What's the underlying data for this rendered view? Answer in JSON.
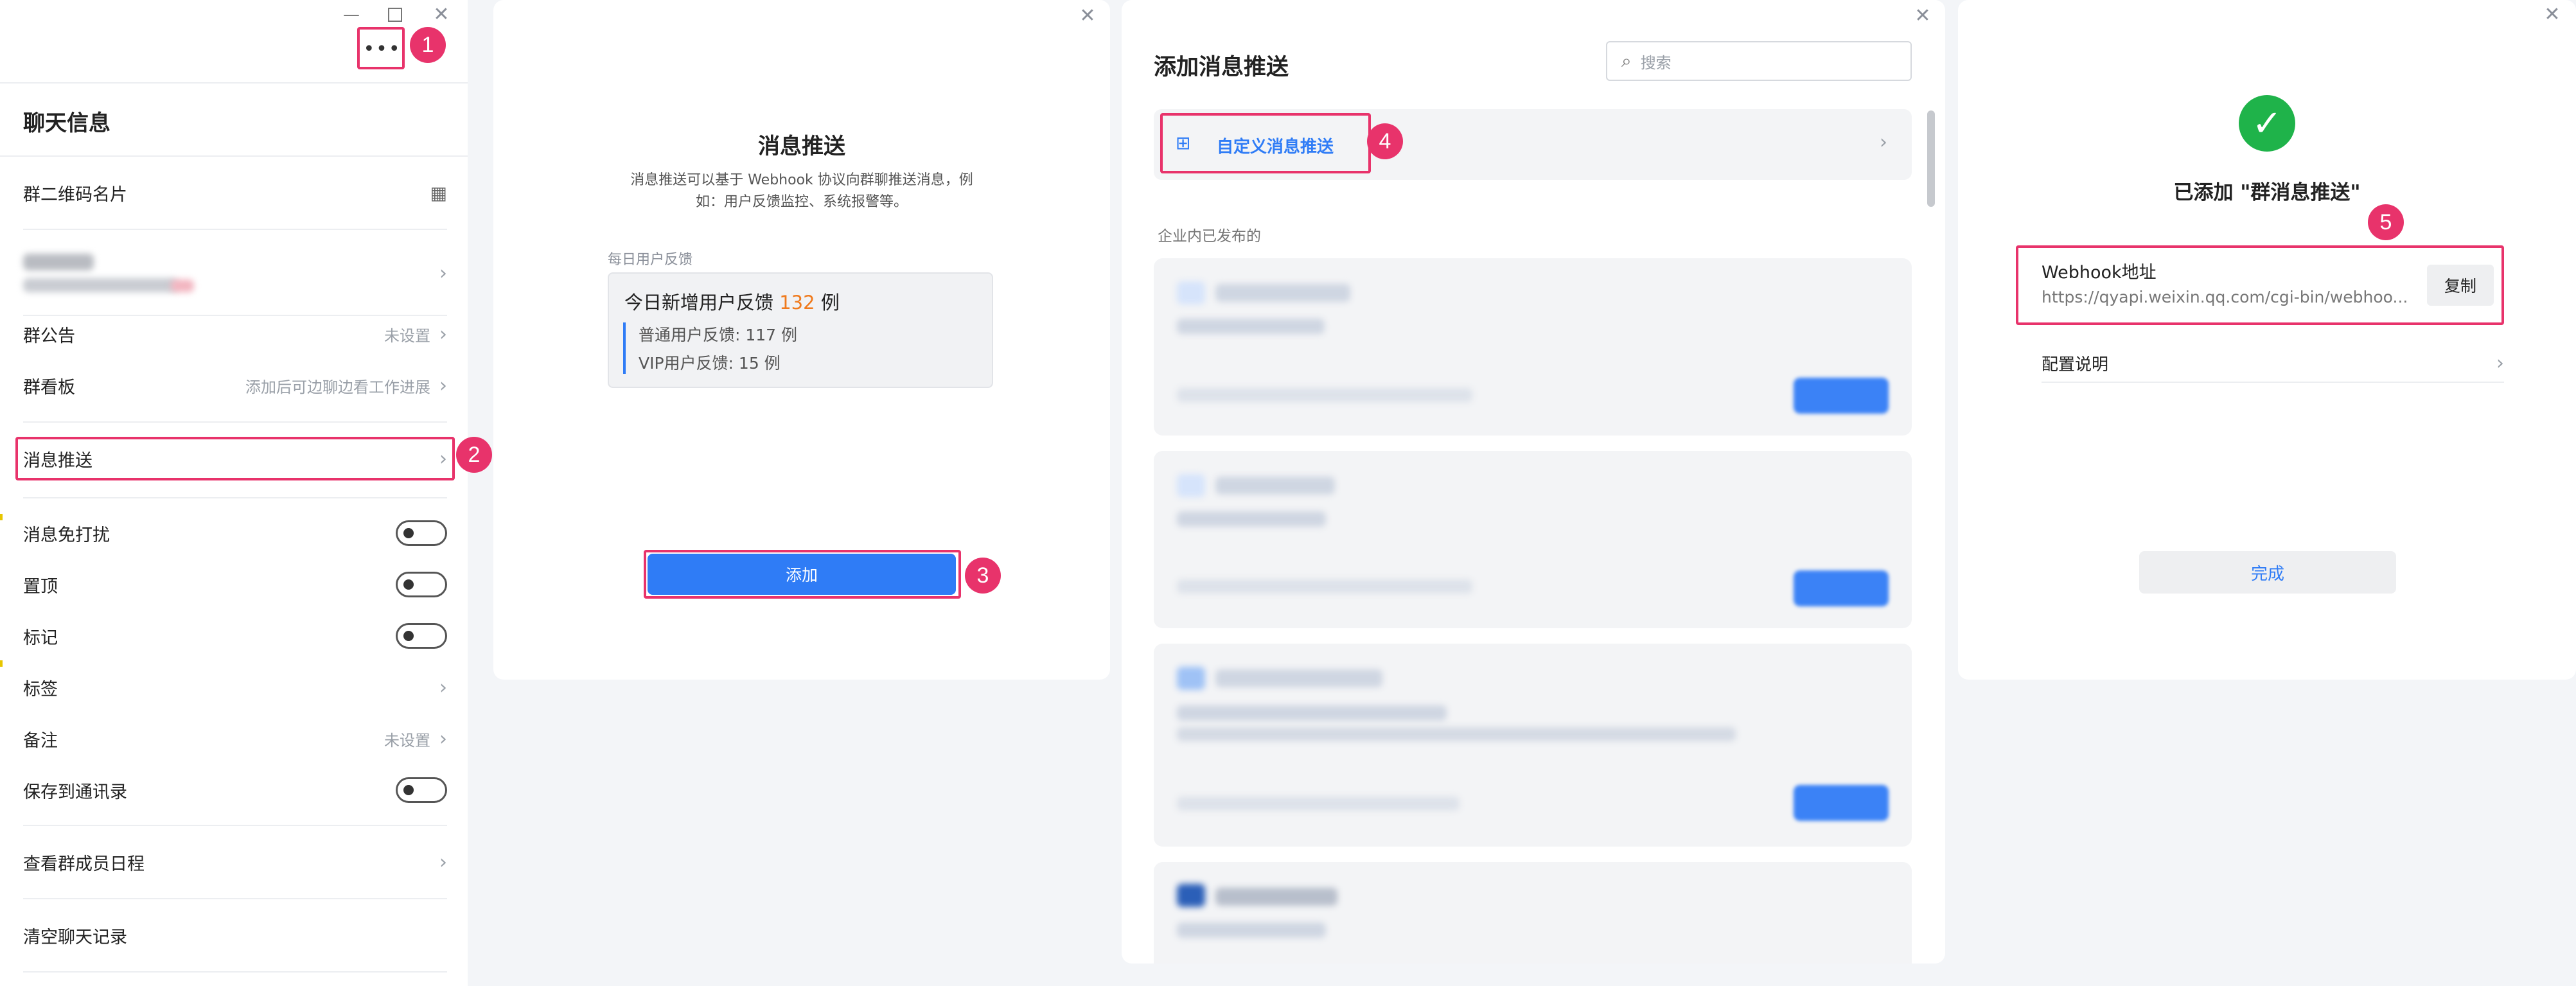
{
  "panel1": {
    "title": "聊天信息",
    "more_icon": "more-horizontal-icon",
    "qr_label": "群二维码名片",
    "group_notice": {
      "label": "群公告",
      "hint": "未设置"
    },
    "group_board": {
      "label": "群看板",
      "hint": "添加后可边聊边看工作进展"
    },
    "message_push": {
      "label": "消息推送"
    },
    "dnd": {
      "label": "消息免打扰"
    },
    "pin": {
      "label": "置顶"
    },
    "mark": {
      "label": "标记"
    },
    "tags": {
      "label": "标签"
    },
    "remark": {
      "label": "备注",
      "hint": "未设置"
    },
    "save_contacts": {
      "label": "保存到通讯录"
    },
    "member_schedule": {
      "label": "查看群成员日程"
    },
    "clear_history": {
      "label": "清空聊天记录"
    }
  },
  "panel2": {
    "title": "消息推送",
    "desc_line1": "消息推送可以基于 Webhook 协议向群聊推送消息，例",
    "desc_line2": "如：用户反馈监控、系统报警等。",
    "preview_label": "每日用户反馈",
    "preview": {
      "headline_prefix": "今日新增用户反馈",
      "headline_count": "132",
      "headline_suffix": "例",
      "line1": "普通用户反馈: 117 例",
      "line2": "VIP用户反馈: 15 例"
    },
    "add_button": "添加"
  },
  "panel3": {
    "title": "添加消息推送",
    "search_placeholder": "搜索",
    "custom_push": "自定义消息推送",
    "section_label": "企业内已发布的"
  },
  "panel4": {
    "success_title": "已添加 \"群消息推送\"",
    "webhook_label": "Webhook地址",
    "webhook_url": "https://qyapi.weixin.qq.com/cgi-bin/webhoo...",
    "copy_button": "复制",
    "config_label": "配置说明",
    "done_button": "完成"
  },
  "markers": [
    "1",
    "2",
    "3",
    "4",
    "5"
  ],
  "colors": {
    "accent": "#2f7cf6",
    "highlight": "#e8336b",
    "orange": "#f07a1c",
    "success": "#1fb34a"
  }
}
